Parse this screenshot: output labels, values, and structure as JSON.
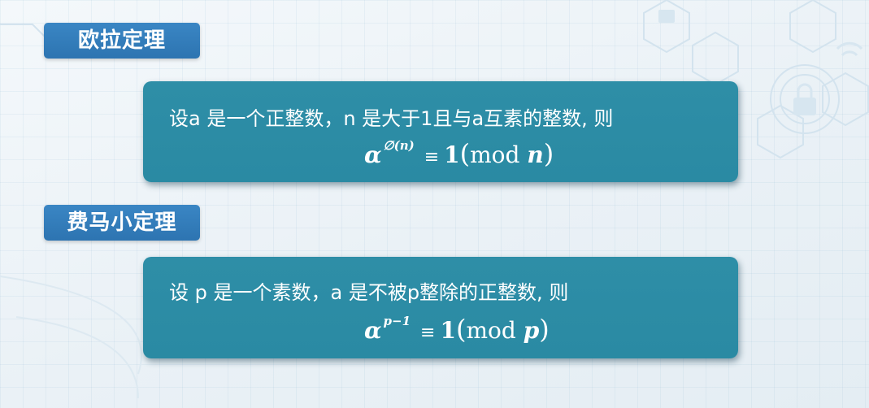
{
  "euler": {
    "title": "欧拉定理",
    "statement": "设a 是一个正整数，n 是大于1且与a互素的整数, 则",
    "formula": {
      "base": "α",
      "exponent": "∅(n)",
      "congruence": "≡",
      "result": "1",
      "open_paren": "(",
      "mod_word": "mod",
      "modulus": "n",
      "close_paren": ")"
    }
  },
  "fermat": {
    "title": "费马小定理",
    "statement": "设 p 是一个素数，a 是不被p整除的正整数, 则",
    "formula": {
      "base": "α",
      "exponent": "p−1",
      "congruence": "≡",
      "result": "1",
      "open_paren": "(",
      "mod_word": "mod",
      "modulus": "p",
      "close_paren": ")"
    }
  },
  "colors": {
    "tag_blue": "#3a86c4",
    "box_teal": "#2e8ea7",
    "background": "#eef4f8"
  }
}
